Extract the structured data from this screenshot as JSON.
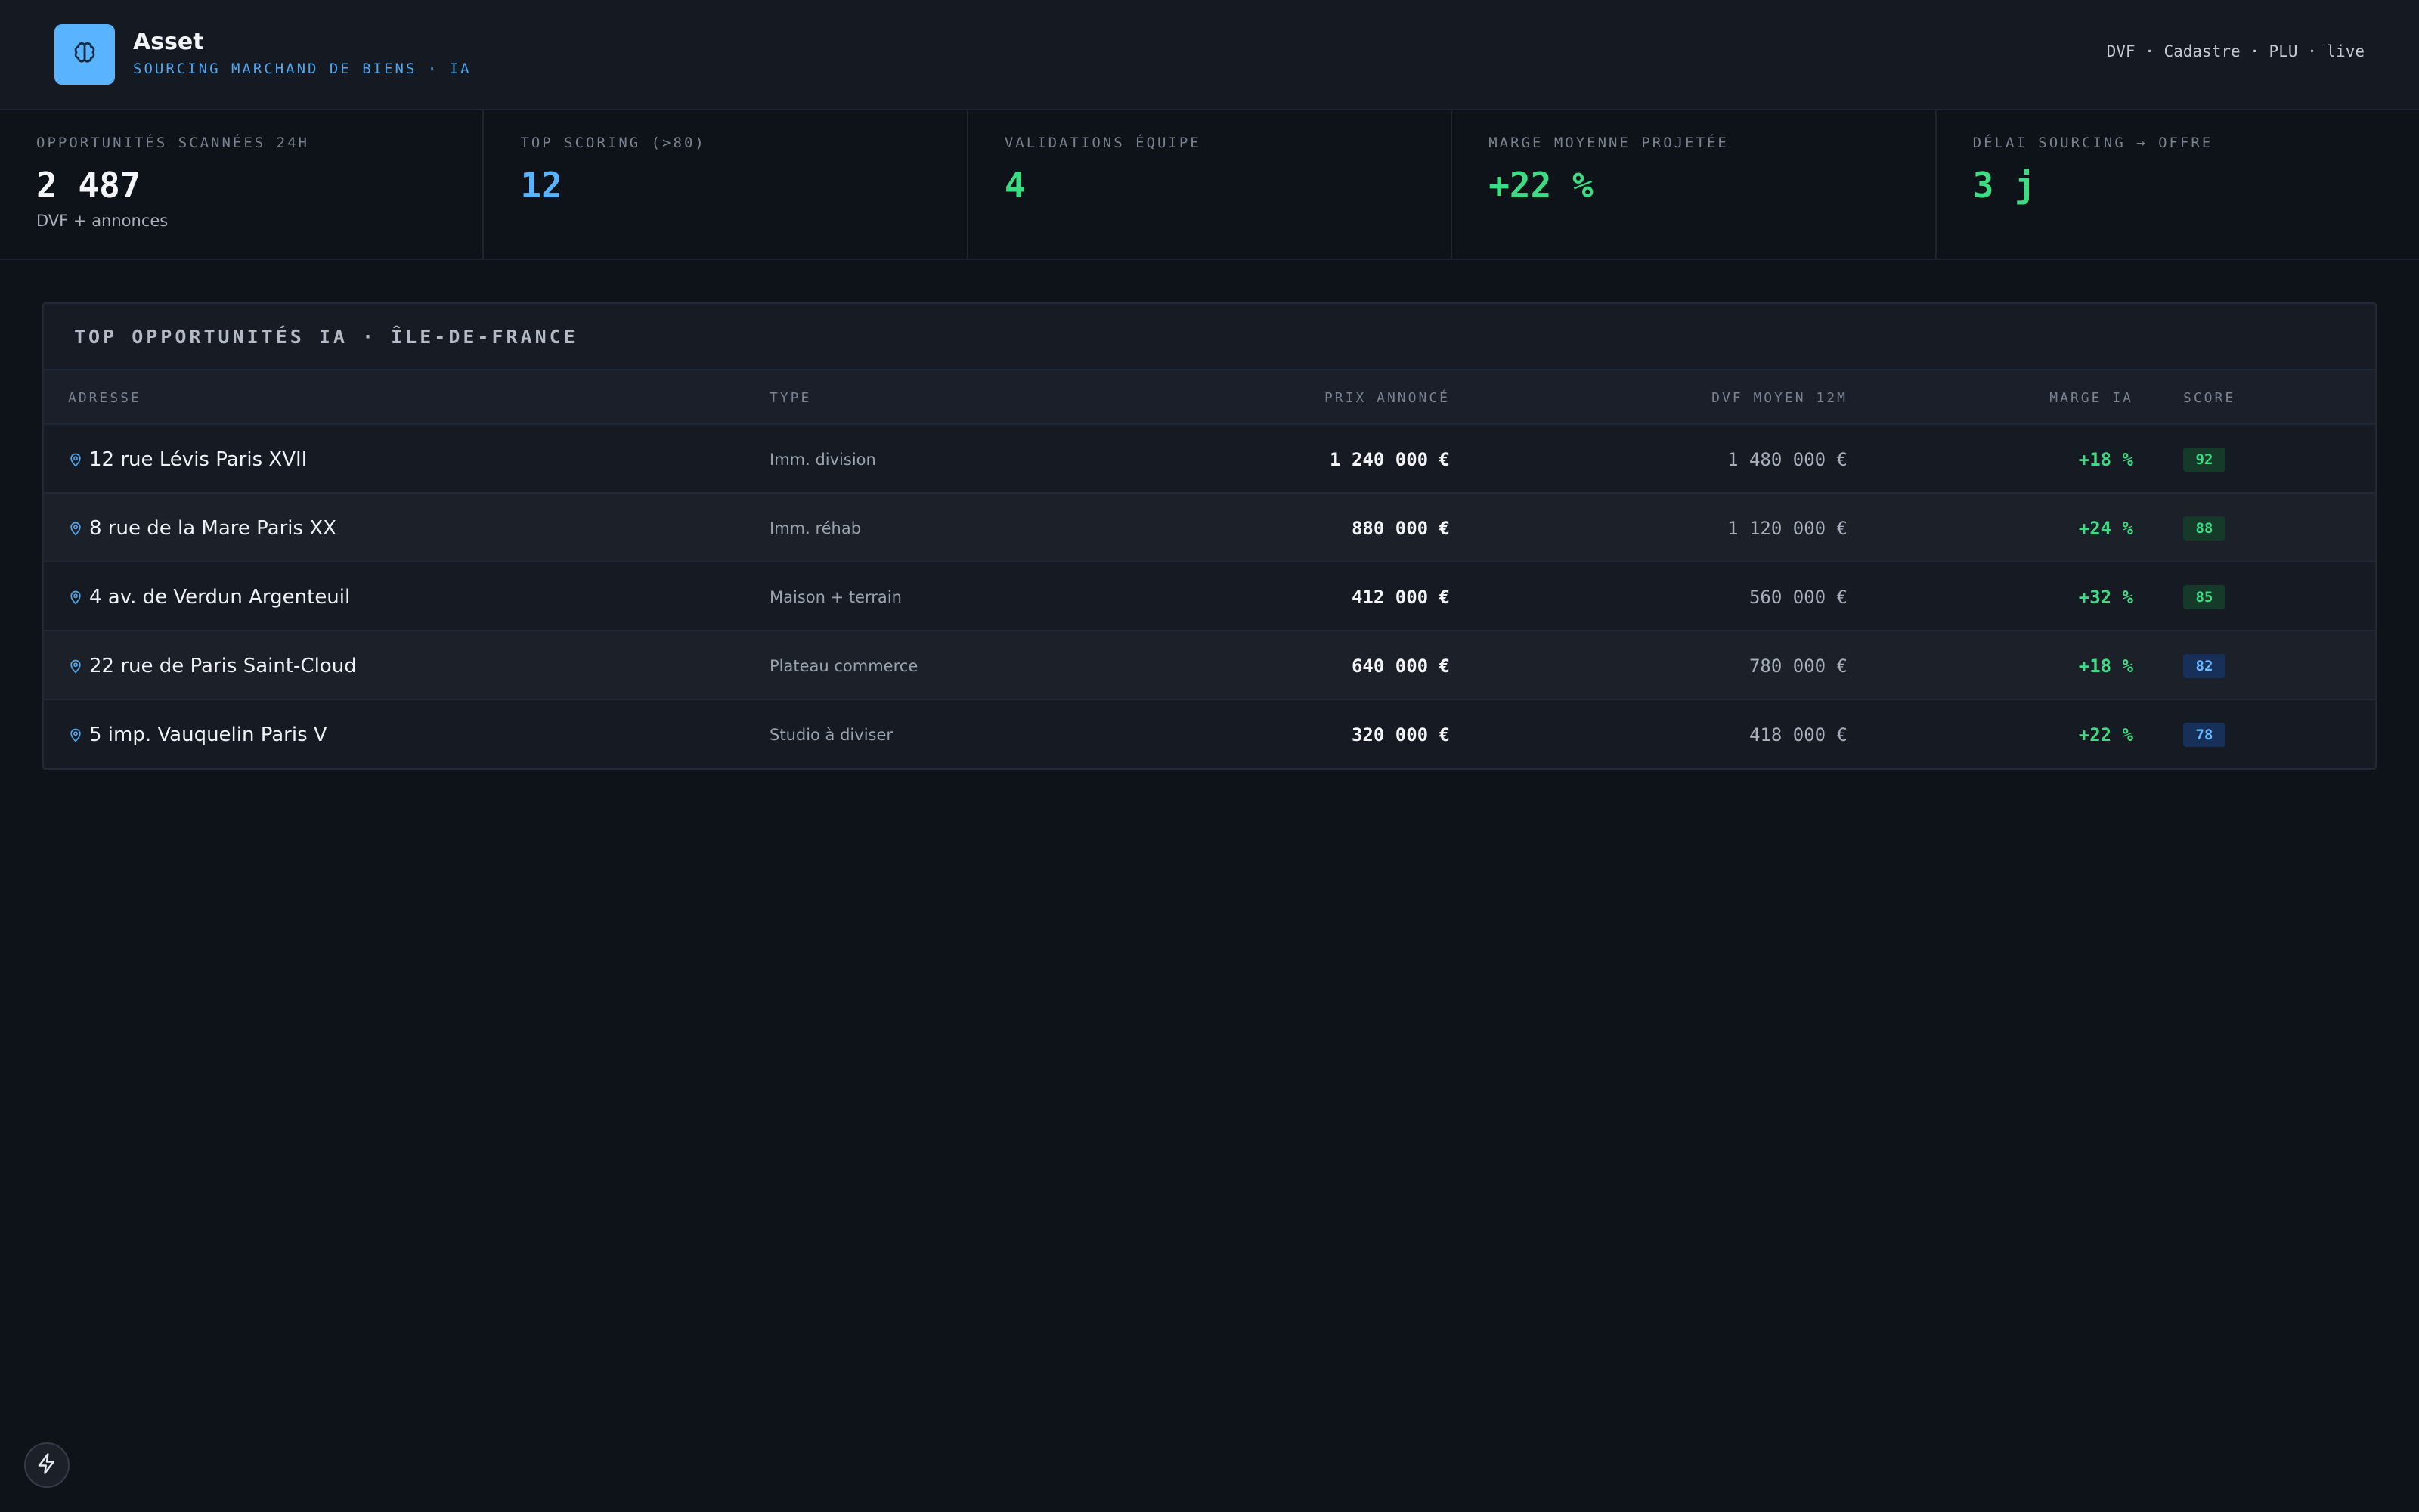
{
  "header": {
    "title": "Asset",
    "subtitle": "SOURCING MARCHAND DE BIENS · IA",
    "sources": "DVF · Cadastre · PLU · live",
    "logo_icon": "brain-icon"
  },
  "kpis": [
    {
      "label": "OPPORTUNITÉS SCANNÉES 24H",
      "value": "2 487",
      "sub": "DVF + annonces",
      "color": "#f3f5f8"
    },
    {
      "label": "TOP SCORING (>80)",
      "value": "12",
      "color": "#5ab3ff"
    },
    {
      "label": "VALIDATIONS ÉQUIPE",
      "value": "4",
      "color": "#3ddc84"
    },
    {
      "label": "MARGE MOYENNE PROJETÉE",
      "value": "+22 %",
      "color": "#3ddc84"
    },
    {
      "label": "DÉLAI SOURCING → OFFRE",
      "value": "3 j",
      "color": "#3ddc84"
    }
  ],
  "table": {
    "title": "TOP OPPORTUNITÉS IA · ÎLE-DE-FRANCE",
    "columns": {
      "address": "ADRESSE",
      "type": "TYPE",
      "price": "PRIX ANNONCÉ",
      "dvf": "DVF MOYEN 12M",
      "margin": "MARGE IA",
      "score": "SCORE"
    },
    "rows": [
      {
        "address": "12 rue Lévis Paris XVII",
        "type": "Imm. division",
        "price": "1 240 000 €",
        "dvf": "1 480 000 €",
        "margin": "+18 %",
        "score": "92",
        "score_color": "green"
      },
      {
        "address": "8 rue de la Mare Paris XX",
        "type": "Imm. réhab",
        "price": "880 000 €",
        "dvf": "1 120 000 €",
        "margin": "+24 %",
        "score": "88",
        "score_color": "green"
      },
      {
        "address": "4 av. de Verdun Argenteuil",
        "type": "Maison + terrain",
        "price": "412 000 €",
        "dvf": "560 000 €",
        "margin": "+32 %",
        "score": "85",
        "score_color": "green"
      },
      {
        "address": "22 rue de Paris Saint-Cloud",
        "type": "Plateau commerce",
        "price": "640 000 €",
        "dvf": "780 000 €",
        "margin": "+18 %",
        "score": "82",
        "score_color": "blue"
      },
      {
        "address": "5 imp. Vauquelin Paris V",
        "type": "Studio à diviser",
        "price": "320 000 €",
        "dvf": "418 000 €",
        "margin": "+22 %",
        "score": "78",
        "score_color": "blue"
      }
    ]
  },
  "colors": {
    "accent": "#5ab3ff",
    "positive": "#3ddc84",
    "background": "#0e1219"
  },
  "fab": {
    "icon": "lightning-icon"
  }
}
